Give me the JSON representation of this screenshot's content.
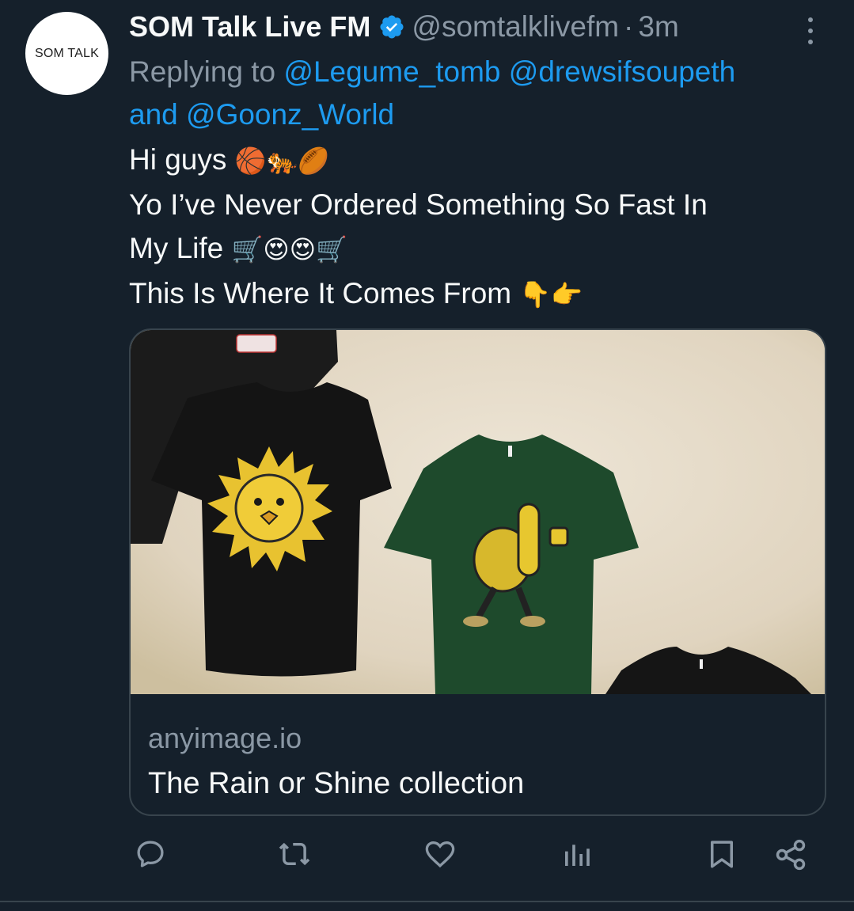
{
  "author": {
    "avatar_text": "SOM TALK",
    "display_name": "SOM Talk Live FM",
    "handle": "@somtalklivefm",
    "separator": "·",
    "time": "3m"
  },
  "reply": {
    "prefix": "Replying to",
    "mention_1": "@Legume_tomb",
    "mention_2": "@drewsifsoupeth",
    "connector": "and",
    "mention_3": "@Goonz_World"
  },
  "tweet": {
    "line_1_text": "Hi guys",
    "line_1_emoji": "🏀🐅🏉",
    "line_2_text": "Yo I’ve Never Ordered Something So Fast In",
    "line_3_text": "My Life",
    "line_3_emoji": "🛒😍😍🛒",
    "line_4_text": "This Is Where It Comes From",
    "line_4_emoji": "👇👉"
  },
  "link_card": {
    "domain": "anyimage.io",
    "title": "The Rain or Shine collection"
  },
  "actions": {
    "reply_icon": "speech-bubble-icon",
    "retweet_icon": "retweet-icon",
    "like_icon": "heart-icon",
    "views_icon": "bar-chart-icon",
    "bookmark_icon": "bookmark-icon",
    "share_icon": "share-icon"
  },
  "colors": {
    "background": "#15202b",
    "link": "#1d9bf0",
    "secondary_text": "#8b98a5",
    "border": "#38444d"
  }
}
